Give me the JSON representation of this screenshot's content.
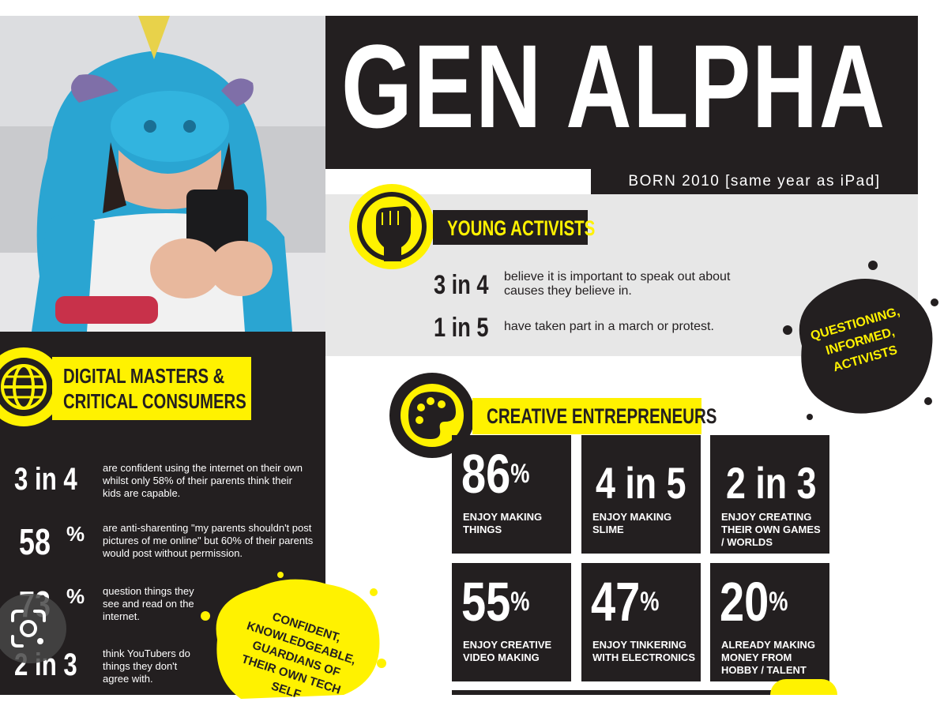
{
  "header": {
    "title": "GEN ALPHA",
    "born": "BORN 2010  [same year as iPad]"
  },
  "young_activists": {
    "label": "YOUNG ACTIVISTS",
    "icon": "raised-fist-icon",
    "stats": [
      {
        "value": "3 in 4",
        "text": "believe it is important to speak out about causes they believe in."
      },
      {
        "value": "1 in 5",
        "text": "have taken part in a march or protest."
      }
    ],
    "splat": "QUESTIONING, INFORMED, ACTIVISTS"
  },
  "digital_masters": {
    "label_line1": "DIGITAL MASTERS &",
    "label_line2": "CRITICAL CONSUMERS",
    "icon": "globe-icon",
    "stats": [
      {
        "value": "3 in 4",
        "text": "are confident using the internet on their own whilst only 58% of their parents think their kids are capable."
      },
      {
        "value": "58",
        "pct": "%",
        "text": "are anti-sharenting \"my parents shouldn't post pictures of me online\" but 60% of their parents would post without permission."
      },
      {
        "value": "73",
        "pct": "%",
        "text": "question things they see and read on the internet."
      },
      {
        "value": "2 in 3",
        "text": "think YouTubers do things they don't agree with."
      }
    ],
    "splat": "CONFIDENT, KNOWLEDGEABLE, GUARDIANS OF THEIR OWN TECH SELF"
  },
  "creative": {
    "label": "CREATIVE ENTREPRENEURS",
    "icon": "palette-icon",
    "tiles": [
      {
        "value": "86",
        "pct": "%",
        "text": "ENJOY MAKING THINGS"
      },
      {
        "value": "4 in 5",
        "pct": "",
        "text": "ENJOY MAKING SLIME"
      },
      {
        "value": "2 in 3",
        "pct": "",
        "text": "ENJOY CREATING THEIR OWN GAMES / WORLDS"
      },
      {
        "value": "55",
        "pct": "%",
        "text": "ENJOY CREATIVE VIDEO MAKING"
      },
      {
        "value": "47",
        "pct": "%",
        "text": "ENJOY TINKERING WITH ELECTRONICS"
      },
      {
        "value": "20",
        "pct": "%",
        "text": "ALREADY MAKING MONEY FROM HOBBY / TALENT"
      }
    ]
  },
  "overlay": {
    "icon": "visual-search-lens-icon"
  },
  "colors": {
    "yellow": "#fff200",
    "dark": "#231f20",
    "grey": "#e7e7e7"
  }
}
